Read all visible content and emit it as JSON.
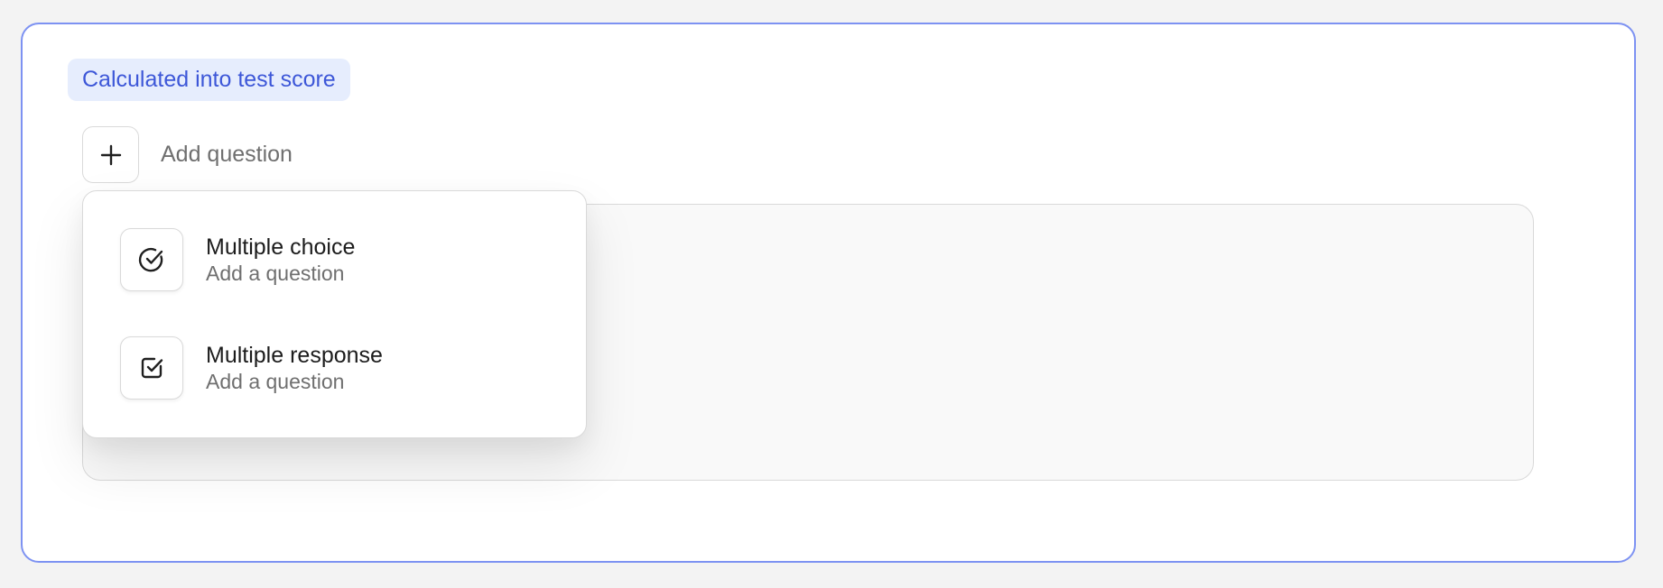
{
  "badge": {
    "label": "Calculated into test score"
  },
  "add_question": {
    "label": "Add question",
    "icon": "plus-icon"
  },
  "menu": {
    "items": [
      {
        "title": "Multiple choice",
        "subtitle": "Add a question",
        "icon": "circle-check-icon"
      },
      {
        "title": "Multiple response",
        "subtitle": "Add a question",
        "icon": "square-check-icon"
      }
    ]
  },
  "colors": {
    "accent_border": "#7d92f2",
    "badge_bg": "#e6edfd",
    "badge_text": "#3d57d8"
  }
}
